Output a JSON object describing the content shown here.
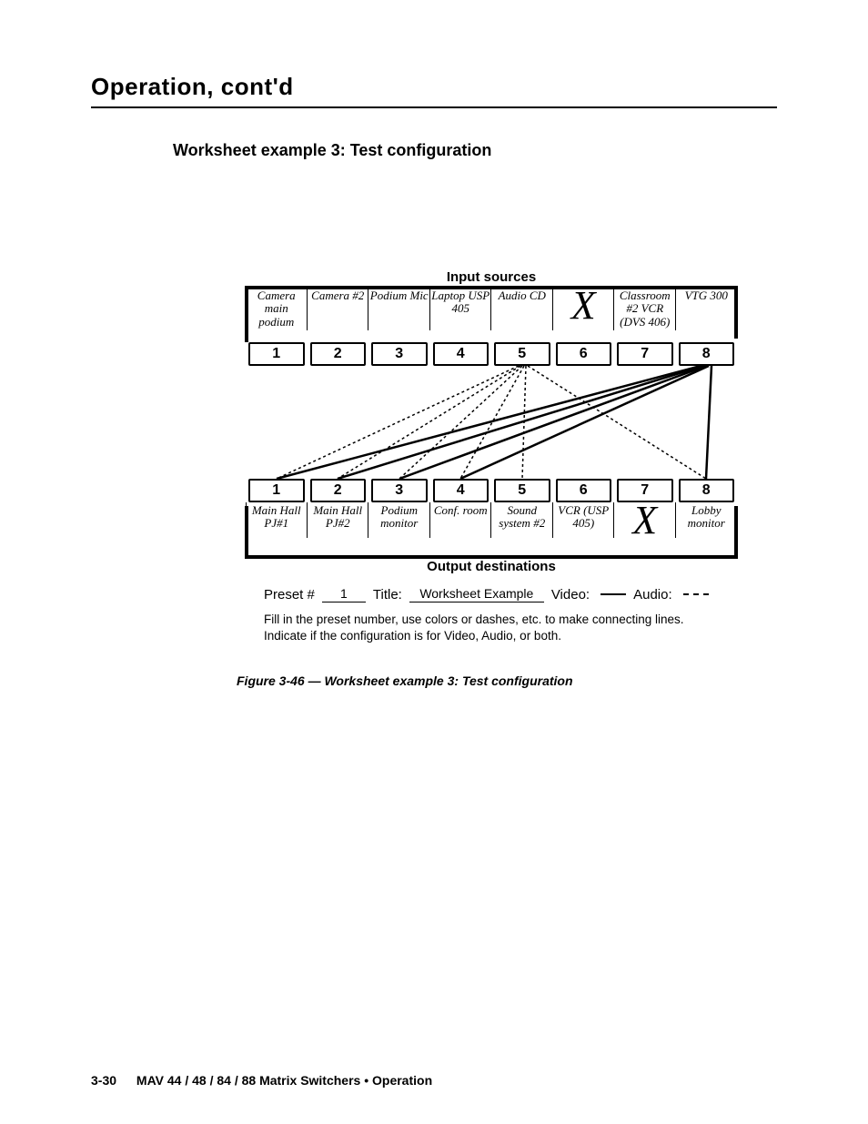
{
  "header": {
    "title": "Operation, cont'd"
  },
  "subheading": "Worksheet example 3: Test configuration",
  "diagram": {
    "top_caption": "Input sources",
    "bottom_caption": "Output destinations",
    "inputs": [
      "Camera main podium",
      "Camera #2",
      "Podium Mic",
      "Laptop USP 405",
      "Audio CD",
      "X",
      "Classroom #2 VCR (DVS 406)",
      "VTG 300"
    ],
    "outputs": [
      "Main Hall PJ#1",
      "Main Hall PJ#2",
      "Podium monitor",
      "Conf. room",
      "Sound system #2",
      "VCR (USP 405)",
      "X",
      "Lobby monitor"
    ],
    "input_nums": [
      "1",
      "2",
      "3",
      "4",
      "5",
      "6",
      "7",
      "8"
    ],
    "output_nums": [
      "1",
      "2",
      "3",
      "4",
      "5",
      "6",
      "7",
      "8"
    ]
  },
  "chart_data": {
    "type": "table",
    "title": "Worksheet example 3: Test configuration",
    "inputs": {
      "1": "Camera main podium",
      "2": "Camera #2",
      "3": "Podium Mic",
      "4": "Laptop USP 405",
      "5": "Audio CD",
      "6": "(unused)",
      "7": "Classroom #2 VCR (DVS 406)",
      "8": "VTG 300"
    },
    "outputs": {
      "1": "Main Hall PJ#1",
      "2": "Main Hall PJ#2",
      "3": "Podium monitor",
      "4": "Conf. room",
      "5": "Sound system #2",
      "6": "VCR (USP 405)",
      "7": "(unused)",
      "8": "Lobby monitor"
    },
    "connections": {
      "video": [
        {
          "from": 8,
          "to": 1
        },
        {
          "from": 8,
          "to": 2
        },
        {
          "from": 8,
          "to": 3
        },
        {
          "from": 8,
          "to": 4
        },
        {
          "from": 8,
          "to": 8
        }
      ],
      "audio": [
        {
          "from": 5,
          "to": 1
        },
        {
          "from": 5,
          "to": 2
        },
        {
          "from": 5,
          "to": 3
        },
        {
          "from": 5,
          "to": 4
        },
        {
          "from": 5,
          "to": 5
        },
        {
          "from": 5,
          "to": 8
        }
      ]
    }
  },
  "form": {
    "preset_label": "Preset #",
    "preset_value": "1",
    "title_label": "Title:",
    "title_value": "Worksheet Example",
    "video_label": "Video:",
    "audio_label": "Audio:"
  },
  "notes": {
    "line1": "Fill in the preset number, use colors or dashes, etc. to make connecting lines.",
    "line2": "Indicate if the configuration is for Video, Audio, or both."
  },
  "figure_caption": "Figure 3-46 — Worksheet example 3: Test configuration",
  "footer": {
    "page": "3-30",
    "book": "MAV 44 / 48 / 84 / 88 Matrix Switchers • Operation"
  }
}
